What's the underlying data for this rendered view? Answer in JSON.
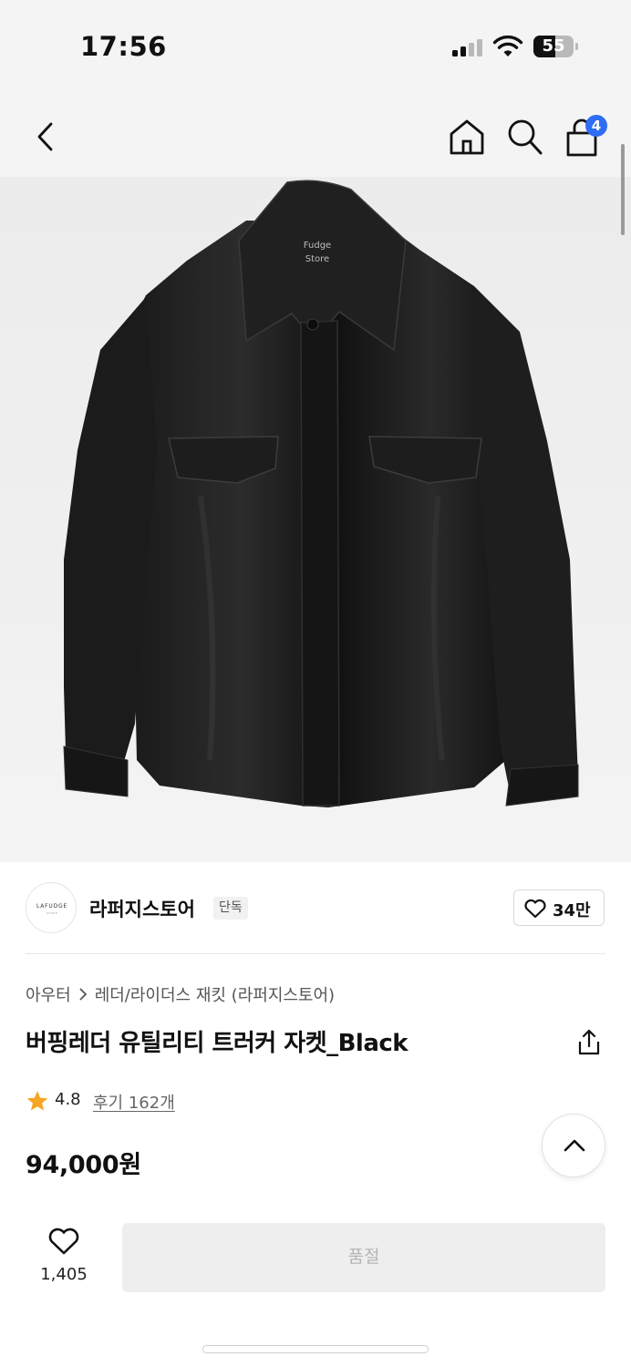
{
  "status_bar": {
    "time": "17:56",
    "battery": "55"
  },
  "header": {
    "cart_count": "4"
  },
  "product_image": {
    "print_line1": "Fudge",
    "print_line2": "Store"
  },
  "brand": {
    "logo_text": "LAFUDGE",
    "logo_sub": "STORE",
    "name": "라퍼지스토어",
    "tag": "단독",
    "likes": "34만"
  },
  "breadcrumb": {
    "category": "아우터",
    "subcategory": "레더/라이더스 재킷 (라퍼지스토어)"
  },
  "product": {
    "title": "버핑레더 유틸리티 트러커 자켓_Black",
    "rating": "4.8",
    "reviews": "후기 162개",
    "price": "94,000원"
  },
  "bottom_bar": {
    "wish_count": "1,405",
    "buy_label": "품절"
  },
  "colors": {
    "accent": "#2f6df5",
    "star": "#f5a623",
    "soldout_bg": "#eeeeee"
  },
  "icons": [
    "back-icon",
    "home-icon",
    "search-icon",
    "cart-icon",
    "heart-icon",
    "share-icon",
    "star-icon",
    "chevron-up-icon"
  ]
}
